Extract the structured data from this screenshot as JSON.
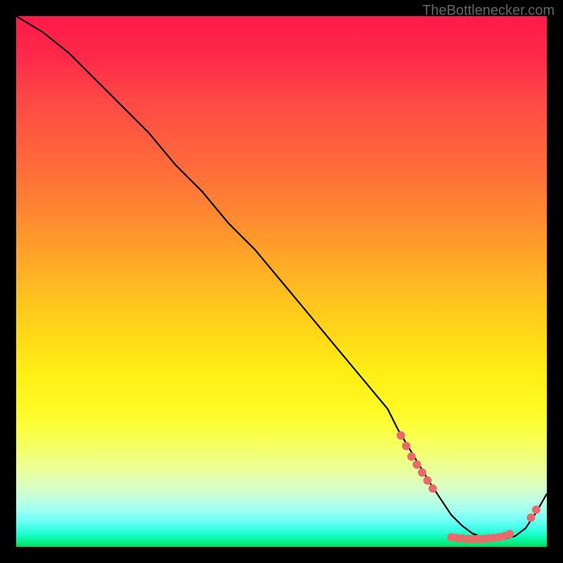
{
  "attribution": "TheBottlenecker.com",
  "chart_data": {
    "type": "line",
    "title": "",
    "xlabel": "",
    "ylabel": "",
    "xlim": [
      0,
      100
    ],
    "ylim": [
      0,
      100
    ],
    "series": [
      {
        "name": "curve",
        "x": [
          0,
          5,
          10,
          15,
          20,
          25,
          30,
          35,
          40,
          45,
          50,
          55,
          60,
          65,
          70,
          72,
          75,
          78,
          80,
          82,
          84,
          86,
          88,
          90,
          92,
          94,
          96,
          98,
          100
        ],
        "y": [
          100,
          97,
          93,
          88,
          83,
          78,
          72,
          67,
          61,
          56,
          50,
          44,
          38,
          32,
          26,
          22,
          17,
          12,
          9,
          6,
          4,
          2.5,
          1.8,
          1.5,
          1.5,
          2,
          3.5,
          6.5,
          10
        ]
      }
    ],
    "markers": [
      {
        "x": 72.5,
        "y": 21
      },
      {
        "x": 73.5,
        "y": 19
      },
      {
        "x": 74.5,
        "y": 17
      },
      {
        "x": 75.5,
        "y": 15.5
      },
      {
        "x": 76.5,
        "y": 14
      },
      {
        "x": 77.5,
        "y": 12.5
      },
      {
        "x": 78.5,
        "y": 11
      },
      {
        "x": 82,
        "y": 1.8
      },
      {
        "x": 83,
        "y": 1.7
      },
      {
        "x": 84,
        "y": 1.6
      },
      {
        "x": 85,
        "y": 1.5
      },
      {
        "x": 86,
        "y": 1.5
      },
      {
        "x": 87,
        "y": 1.5
      },
      {
        "x": 88,
        "y": 1.5
      },
      {
        "x": 89,
        "y": 1.6
      },
      {
        "x": 90,
        "y": 1.7
      },
      {
        "x": 91,
        "y": 1.8
      },
      {
        "x": 92,
        "y": 2.0
      },
      {
        "x": 93,
        "y": 2.4
      },
      {
        "x": 97,
        "y": 5.5
      },
      {
        "x": 98,
        "y": 7
      }
    ],
    "gradient_stops": [
      {
        "pos": 0,
        "color": "#ff1a4a"
      },
      {
        "pos": 50,
        "color": "#ffd818"
      },
      {
        "pos": 80,
        "color": "#fcff40"
      },
      {
        "pos": 100,
        "color": "#00e060"
      }
    ]
  }
}
